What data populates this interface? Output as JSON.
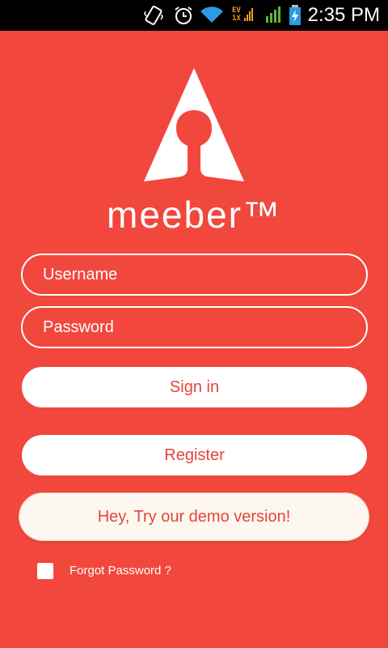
{
  "status_bar": {
    "time": "2:35 PM",
    "network_label_top": "EV",
    "network_label_bottom": "1X",
    "icons": [
      "vibrate-icon",
      "alarm-icon",
      "wifi-icon",
      "signal-icon",
      "battery-charging-icon"
    ]
  },
  "app": {
    "brand": "meeber™",
    "accent_color": "#f2473c"
  },
  "form": {
    "username_placeholder": "Username",
    "password_placeholder": "Password"
  },
  "buttons": {
    "sign_in": "Sign in",
    "register": "Register",
    "demo": "Hey, Try our demo version!"
  },
  "forgot": {
    "label": "Forgot Password ?",
    "checked": false
  }
}
